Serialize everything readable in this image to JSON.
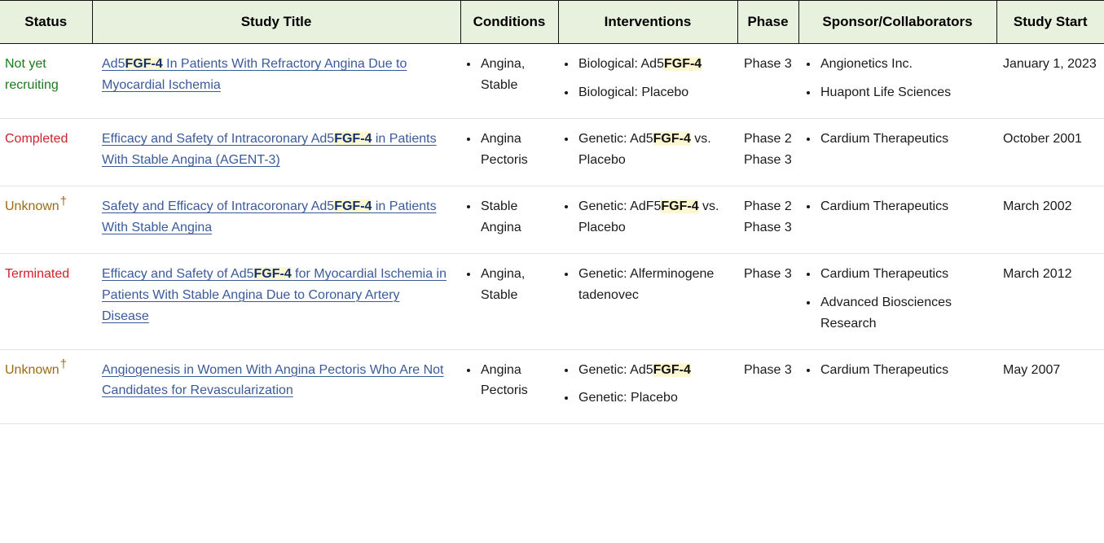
{
  "table": {
    "columns": [
      {
        "key": "status",
        "label": "Status"
      },
      {
        "key": "title",
        "label": "Study Title"
      },
      {
        "key": "conditions",
        "label": "Conditions"
      },
      {
        "key": "interventions",
        "label": "Interventions"
      },
      {
        "key": "phase",
        "label": "Phase"
      },
      {
        "key": "sponsor",
        "label": "Sponsor/Collaborators"
      },
      {
        "key": "start",
        "label": "Study Start"
      }
    ],
    "colors": {
      "header_background": "#e8f0de",
      "header_border": "#111111",
      "row_divider": "#e2e2e2",
      "link": "#3b5a9a",
      "highlight_background": "#fdf8d2",
      "status_recruiting": "#1a7a1a",
      "status_completed": "#d4202a",
      "status_terminated": "#d4202a",
      "status_unknown": "#9a6b13"
    },
    "highlight_term": "FGF-4",
    "unknown_marker": "†",
    "rows": [
      {
        "status": "Not yet recruiting",
        "status_state": "not-yet-recruiting",
        "status_has_dagger": false,
        "title_parts": [
          {
            "text": "Ad5",
            "highlight": false
          },
          {
            "text": "FGF-4",
            "highlight": true
          },
          {
            "text": " In Patients With Refractory Angina Due to Myocardial Ischemia",
            "highlight": false
          }
        ],
        "title_plain": "Ad5FGF-4 In Patients With Refractory Angina Due to Myocardial Ischemia",
        "conditions": [
          "Angina, Stable"
        ],
        "interventions": [
          [
            {
              "text": "Biological: Ad5",
              "highlight": false
            },
            {
              "text": "FGF-4",
              "highlight": true
            }
          ],
          [
            {
              "text": "Biological: Placebo",
              "highlight": false
            }
          ]
        ],
        "phase": [
          "Phase 3"
        ],
        "sponsors": [
          "Angionetics Inc.",
          "Huapont Life Sciences"
        ],
        "start": "January 1, 2023"
      },
      {
        "status": "Completed",
        "status_state": "completed",
        "status_has_dagger": false,
        "title_parts": [
          {
            "text": "Efficacy and Safety of Intracoronary Ad5",
            "highlight": false
          },
          {
            "text": "FGF-4",
            "highlight": true
          },
          {
            "text": " in Patients With Stable Angina (AGENT-3)",
            "highlight": false
          }
        ],
        "title_plain": "Efficacy and Safety of Intracoronary Ad5FGF-4 in Patients With Stable Angina (AGENT-3)",
        "conditions": [
          "Angina Pectoris"
        ],
        "interventions": [
          [
            {
              "text": "Genetic: Ad5",
              "highlight": false
            },
            {
              "text": "FGF-4",
              "highlight": true
            },
            {
              "text": " vs. Placebo",
              "highlight": false
            }
          ]
        ],
        "phase": [
          "Phase 2",
          "Phase 3"
        ],
        "sponsors": [
          "Cardium Therapeutics"
        ],
        "start": "October 2001"
      },
      {
        "status": "Unknown",
        "status_state": "unknown",
        "status_has_dagger": true,
        "title_parts": [
          {
            "text": "Safety and Efficacy of Intracoronary Ad5",
            "highlight": false
          },
          {
            "text": "FGF-4",
            "highlight": true
          },
          {
            "text": " in Patients With Stable Angina",
            "highlight": false
          }
        ],
        "title_plain": "Safety and Efficacy of Intracoronary Ad5FGF-4 in Patients With Stable Angina",
        "conditions": [
          "Stable Angina"
        ],
        "interventions": [
          [
            {
              "text": "Genetic: AdF5",
              "highlight": false
            },
            {
              "text": "FGF-4",
              "highlight": true
            },
            {
              "text": " vs. Placebo",
              "highlight": false
            }
          ]
        ],
        "phase": [
          "Phase 2",
          "Phase 3"
        ],
        "sponsors": [
          "Cardium Therapeutics"
        ],
        "start": "March 2002"
      },
      {
        "status": "Terminated",
        "status_state": "terminated",
        "status_has_dagger": false,
        "title_parts": [
          {
            "text": "Efficacy and Safety of Ad5",
            "highlight": false
          },
          {
            "text": "FGF-4",
            "highlight": true
          },
          {
            "text": " for Myocardial Ischemia in Patients With Stable Angina Due to Coronary Artery Disease",
            "highlight": false
          }
        ],
        "title_plain": "Efficacy and Safety of Ad5FGF-4 for Myocardial Ischemia in Patients With Stable Angina Due to Coronary Artery Disease",
        "conditions": [
          "Angina, Stable"
        ],
        "interventions": [
          [
            {
              "text": "Genetic: Alferminogene tadenovec",
              "highlight": false
            }
          ]
        ],
        "phase": [
          "Phase 3"
        ],
        "sponsors": [
          "Cardium Therapeutics",
          "Advanced Biosciences Research"
        ],
        "start": "March 2012"
      },
      {
        "status": "Unknown",
        "status_state": "unknown",
        "status_has_dagger": true,
        "title_parts": [
          {
            "text": "Angiogenesis in Women With Angina Pectoris Who Are Not Candidates for Revascularization",
            "highlight": false
          }
        ],
        "title_plain": "Angiogenesis in Women With Angina Pectoris Who Are Not Candidates for Revascularization",
        "conditions": [
          "Angina Pectoris"
        ],
        "interventions": [
          [
            {
              "text": "Genetic: Ad5",
              "highlight": false
            },
            {
              "text": "FGF-4",
              "highlight": true
            }
          ],
          [
            {
              "text": "Genetic: Placebo",
              "highlight": false
            }
          ]
        ],
        "phase": [
          "Phase 3"
        ],
        "sponsors": [
          "Cardium Therapeutics"
        ],
        "start": "May 2007"
      }
    ]
  }
}
